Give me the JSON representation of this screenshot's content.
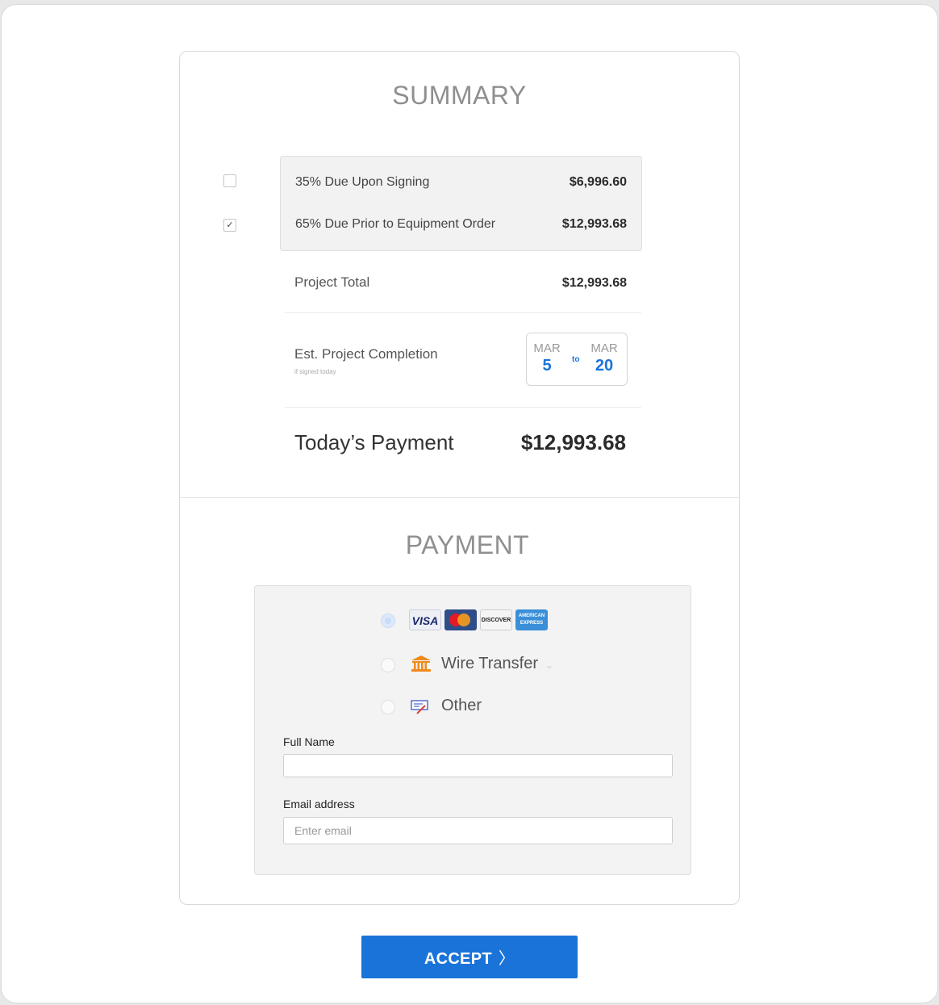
{
  "summary": {
    "title": "SUMMARY",
    "items": [
      {
        "label": "35% Due Upon Signing",
        "amount": "$6,996.60",
        "checked": false
      },
      {
        "label": "65% Due Prior to Equipment Order",
        "amount": "$12,993.68",
        "checked": true
      }
    ],
    "project_total": {
      "label": "Project Total",
      "amount": "$12,993.68"
    },
    "completion": {
      "label": "Est. Project Completion",
      "sublabel": "if signed today",
      "from_month": "MAR",
      "from_day": "5",
      "to_text": "to",
      "to_month": "MAR",
      "to_day": "20"
    },
    "today": {
      "label": "Today’s Payment",
      "amount": "$12,993.68"
    }
  },
  "payment": {
    "title": "PAYMENT",
    "options": [
      {
        "id": "card",
        "cards": [
          "VISA",
          "MasterCard",
          "DISCOVER",
          "AMERICAN EXPRESS"
        ],
        "selected": true
      },
      {
        "id": "wire",
        "label": "Wire Transfer",
        "icon": "bank-icon",
        "selected": false
      },
      {
        "id": "other",
        "label": "Other",
        "icon": "check-payment-icon",
        "selected": false
      }
    ],
    "full_name": {
      "label": "Full Name",
      "value": "",
      "placeholder": ""
    },
    "email": {
      "label": "Email address",
      "value": "",
      "placeholder": "Enter email"
    }
  },
  "accept_button": {
    "label": "ACCEPT",
    "chevron": "〉"
  },
  "colors": {
    "accent": "#1a73d9",
    "heading": "#8f8f8f"
  }
}
